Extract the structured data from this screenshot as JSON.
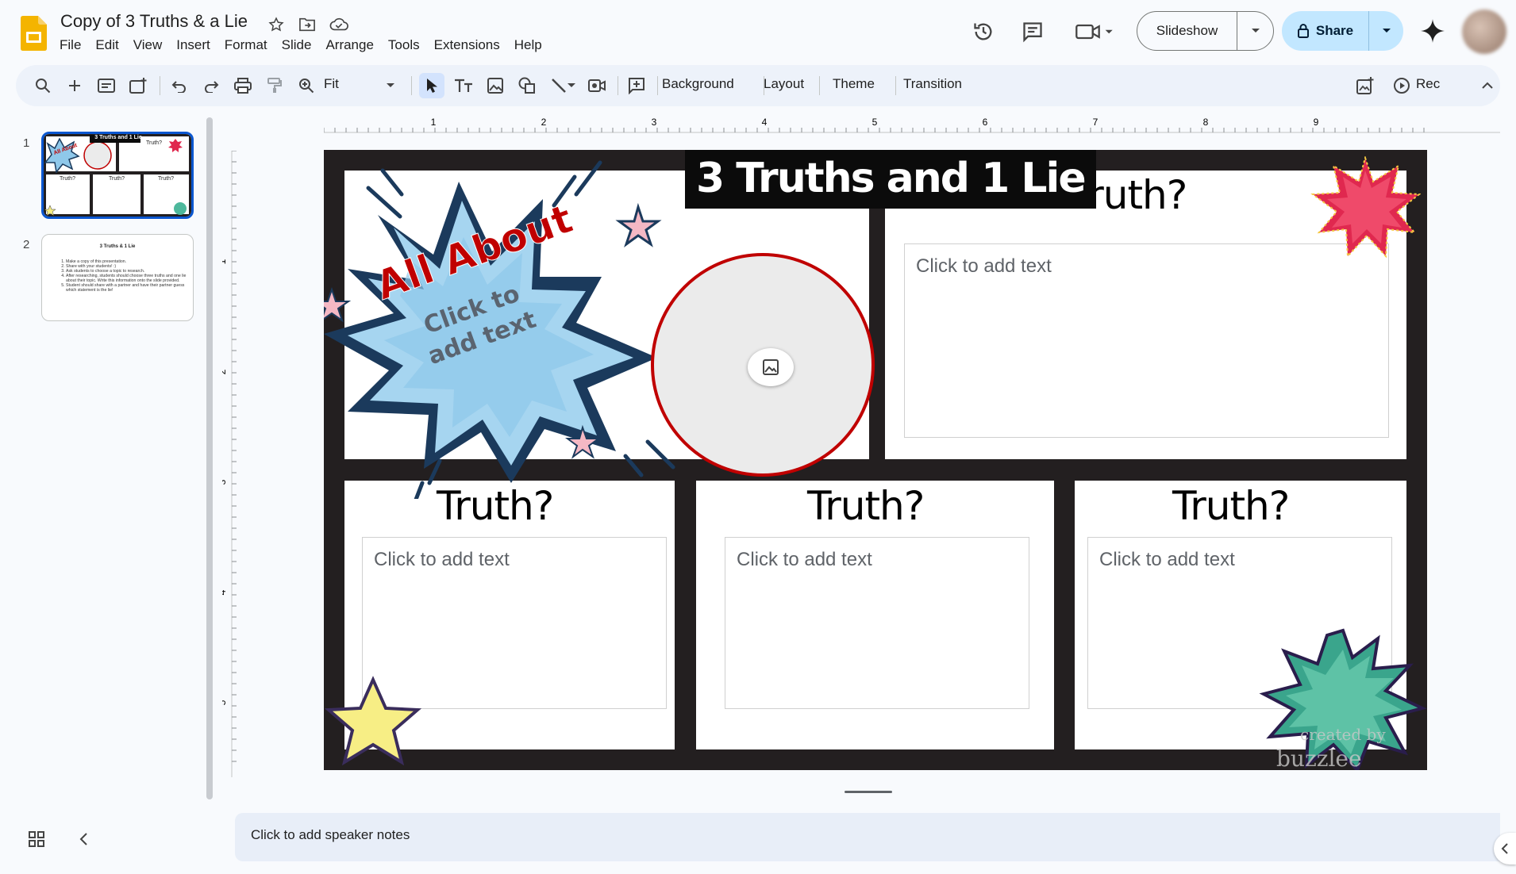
{
  "app": {
    "doc_title": "Copy of 3 Truths & a Lie",
    "menu": [
      "File",
      "Edit",
      "View",
      "Insert",
      "Format",
      "Slide",
      "Arrange",
      "Tools",
      "Extensions",
      "Help"
    ],
    "slideshow_label": "Slideshow",
    "share_label": "Share"
  },
  "toolbar": {
    "zoom_label": "Fit",
    "background_label": "Background",
    "layout_label": "Layout",
    "theme_label": "Theme",
    "transition_label": "Transition",
    "rec_label": "Rec"
  },
  "filmstrip": {
    "slides": [
      {
        "number": "1",
        "title": "3 Truths and 1 Lie",
        "labels": [
          "Truth?",
          "Truth?",
          "Truth?",
          "Truth?"
        ],
        "badge": "All About"
      },
      {
        "number": "2",
        "title": "3 Truths & 1 Lie",
        "lines": [
          "Make a copy of this presentation.",
          "Share with your students! :)",
          "Ask students to choose a topic to research.",
          "After researching, students should choose three truths and one lie about their topic. Write this information onto the slide provided.",
          "Student should share with a partner and have their partner guess which statement is the lie!"
        ]
      }
    ]
  },
  "rulers": {
    "horizontal": [
      "1",
      "2",
      "3",
      "4",
      "5",
      "6",
      "7",
      "8",
      "9"
    ],
    "vertical": [
      "1",
      "2",
      "3",
      "4",
      "5"
    ]
  },
  "slide": {
    "title": "3 Truths and 1 Lie",
    "burst_heading": "All About",
    "burst_placeholder": "Click to add text",
    "truth_label": "Truth?",
    "placeholder": "Click to add text",
    "watermark_line1": "created by",
    "watermark_line2": "buzzlee"
  },
  "notes": {
    "placeholder": "Click to add speaker notes"
  },
  "colors": {
    "accent_blue": "#0b57d0",
    "share_bg": "#c2e7ff",
    "slides_yellow": "#f4b400",
    "slide_frame": "#231f20",
    "title_red": "#c00000"
  }
}
